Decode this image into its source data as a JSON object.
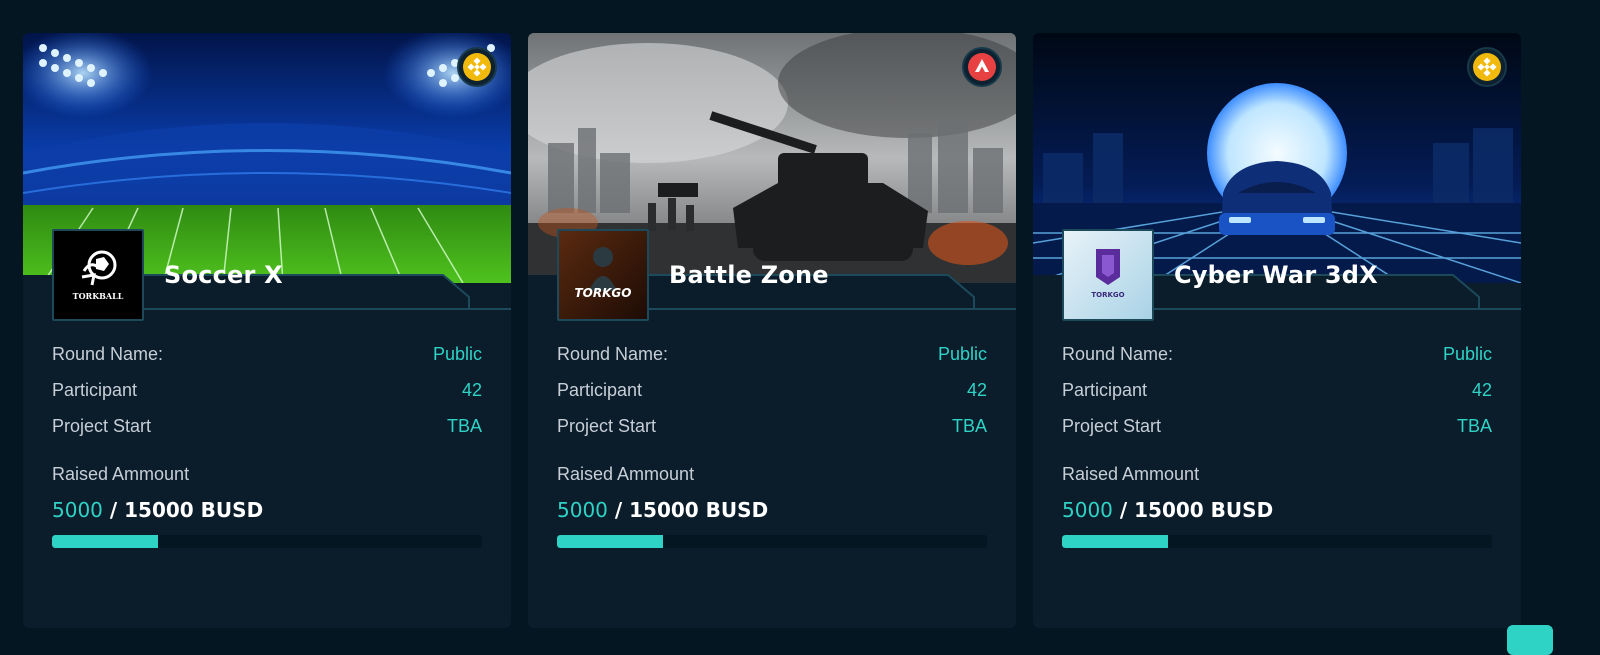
{
  "colors": {
    "background": "#041621",
    "card": "#0b1c2b",
    "accent": "#2fd3c6",
    "label": "#c6ced6",
    "title": "#ffffff"
  },
  "cards": [
    {
      "title": "Soccer X",
      "chain_icon": "binance-coin-icon",
      "banner": "stadium-image",
      "logo_text": "TORKBALL",
      "round_label": "Round Name:",
      "round_value": "Public",
      "participant_label": "Participant",
      "participant_value": "42",
      "start_label": "Project Start",
      "start_value": "TBA",
      "raised_label": "Raised Ammount",
      "raised_current": "5000",
      "raised_total": " / 15000 BUSD",
      "progress_fraction": 0.2467
    },
    {
      "title": "Battle Zone",
      "chain_icon": "avalanche-icon",
      "banner": "tank-battlefield-image",
      "logo_text": "TORKGO",
      "round_label": "Round Name:",
      "round_value": "Public",
      "participant_label": "Participant",
      "participant_value": "42",
      "start_label": "Project Start",
      "start_value": "TBA",
      "raised_label": "Raised Ammount",
      "raised_current": "5000",
      "raised_total": " / 15000 BUSD",
      "progress_fraction": 0.2467
    },
    {
      "title": "Cyber War 3dX",
      "chain_icon": "binance-coin-icon",
      "banner": "neon-car-image",
      "logo_text": "TORKGO",
      "round_label": "Round Name:",
      "round_value": "Public",
      "participant_label": "Participant",
      "participant_value": "42",
      "start_label": "Project Start",
      "start_value": "TBA",
      "raised_label": "Raised Ammount",
      "raised_current": "5000",
      "raised_total": " / 15000 BUSD",
      "progress_fraction": 0.2467
    }
  ]
}
